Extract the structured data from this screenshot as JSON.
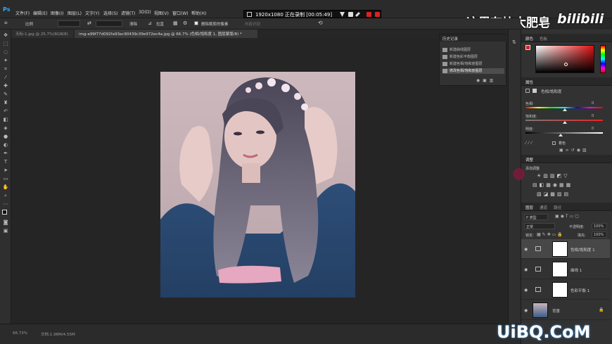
{
  "app": {
    "logo": "Ps"
  },
  "menu": [
    "文件(F)",
    "编辑(E)",
    "图像(I)",
    "图层(L)",
    "文字(Y)",
    "选择(S)",
    "滤镜(T)",
    "3D(D)",
    "视图(V)",
    "窗口(W)",
    "帮助(H)"
  ],
  "recorder": {
    "text": "1920x1080  正在录制 [00:05:49]"
  },
  "watermarks": {
    "top": "这里有块大肥皂",
    "bili": "bilibili",
    "bottom": "UiBQ.CoM"
  },
  "options": {
    "ratio_label": "比例",
    "clear_label": "清除",
    "straighten_label": "拉直",
    "delete_cropped_label": "删除裁剪的像素",
    "content_aware_label": "内容识别"
  },
  "tabs": [
    {
      "label": "无标-1.jpg @ 25.7%(RGB/8)"
    },
    {
      "label": "img-a99f77d092fa93ec90439c39e972ec4a.jpg @ 66.7% (色相/饱和度 1, 图层蒙版/8) *"
    }
  ],
  "history": {
    "title": "历史记录",
    "items": [
      "新建曲线图层",
      "新建色彩平衡图层",
      "新建色相/饱和度图层",
      "修改色相/饱和度图层"
    ],
    "active_index": 3
  },
  "color_panel": {
    "tabs": [
      "颜色",
      "色板"
    ]
  },
  "properties": {
    "title": "属性",
    "subtitle": "色相/饱和度",
    "hue_label": "色相:",
    "hue_value": "0",
    "sat_label": "饱和度:",
    "sat_value": "0",
    "light_label": "明度:",
    "light_value": "0",
    "colorize_label": "着色"
  },
  "adjustments": {
    "title": "调整",
    "subtitle": "添加调整"
  },
  "layers_panel": {
    "tabs": [
      "图层",
      "通道",
      "路径"
    ],
    "kind_label": "P 类型",
    "blend_mode": "正常",
    "opacity_label": "不透明度:",
    "opacity_value": "100%",
    "lock_label": "锁定:",
    "fill_label": "填充:",
    "fill_value": "100%",
    "layers": [
      {
        "name": "色相/饱和度 1",
        "active": true
      },
      {
        "name": "曲线 1",
        "active": false
      },
      {
        "name": "色彩平衡 1",
        "active": false
      },
      {
        "name": "背景",
        "active": false
      }
    ]
  },
  "status": {
    "zoom": "66.73%",
    "doc": "文档:1.98M/4.55M"
  }
}
